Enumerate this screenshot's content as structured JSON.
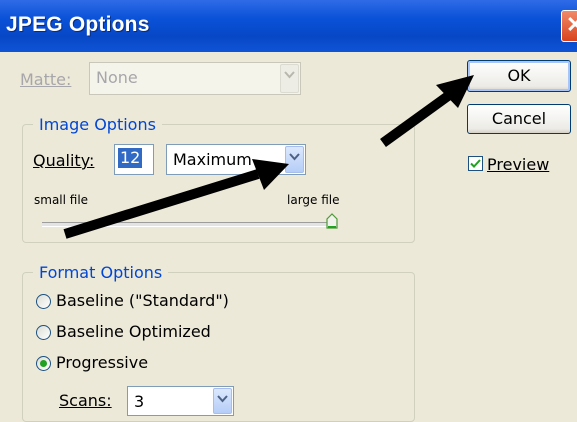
{
  "window": {
    "title": "JPEG Options",
    "close_glyph": "✕"
  },
  "matte": {
    "label": "Matte:",
    "value": "None"
  },
  "buttons": {
    "ok": "OK",
    "cancel": "Cancel"
  },
  "preview": {
    "label": "Preview",
    "checked": true
  },
  "image_options": {
    "title": "Image Options",
    "quality_label": "Quality:",
    "quality_value": "12",
    "quality_preset": "Maximum",
    "small_label": "small file",
    "large_label": "large file",
    "quality_slider_fraction": 1.0
  },
  "format_options": {
    "title": "Format Options",
    "radios": [
      {
        "label": "Baseline (\"Standard\")",
        "selected": false
      },
      {
        "label": "Baseline Optimized",
        "selected": false
      },
      {
        "label": "Progressive",
        "selected": true
      }
    ],
    "scans_label": "Scans:",
    "scans_value": "3"
  },
  "colors": {
    "title_bar": "#0A52D8",
    "dialog_bg": "#ECE9D8",
    "group_title": "#0046D5",
    "annotation_arrow": "#000000"
  },
  "icons": [
    "close-icon",
    "chevron-down-icon",
    "check-icon",
    "slider-thumb-icon",
    "annotation-arrow"
  ]
}
